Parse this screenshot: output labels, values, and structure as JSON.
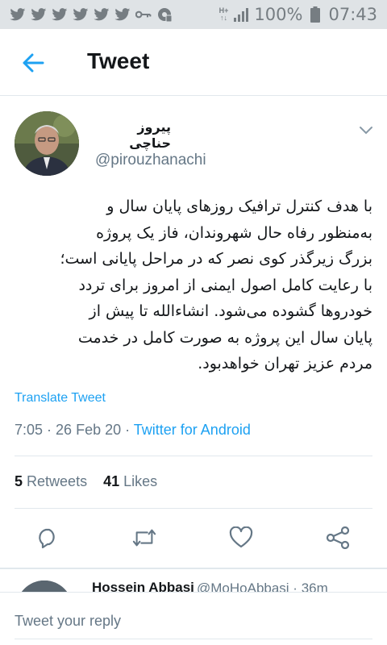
{
  "status_bar": {
    "notification_icons": [
      "twitter-icon",
      "twitter-icon",
      "twitter-icon",
      "twitter-icon",
      "twitter-icon",
      "twitter-icon",
      "key-icon",
      "vpn-icon"
    ],
    "network_type_top": "H+",
    "network_type_bottom": "↑↓",
    "battery": "100%",
    "time": "07:43"
  },
  "header": {
    "title": "Tweet",
    "back_icon": "arrow-left-icon"
  },
  "tweet": {
    "author_name": "پیروز حناچی",
    "author_handle": "@pirouzhanachi",
    "text_lines": [
      "با هدف کنترل ترافیک روزهای پایان سال و",
      "به‌منظور رفاه حال شهروندان، فاز یک پروژه",
      "بزرگ زیرگذر کوی نصر که در مراحل پایانی است؛",
      "با رعایت کامل اصول ایمنی از امروز برای تردد",
      "خودروها گشوده می‌شود. انشاءالله تا پیش از",
      "پایان سال این پروژه به صورت کامل در خدمت",
      "مردم عزیز تهران خواهدبود."
    ],
    "translate_label": "Translate Tweet",
    "time": "7:05",
    "date": "26 Feb 20",
    "source": "Twitter for Android",
    "separator": " · ",
    "retweets_count": "5",
    "retweets_label": "Retweets",
    "likes_count": "41",
    "likes_label": "Likes"
  },
  "actions": [
    "reply-icon",
    "retweet-icon",
    "like-icon",
    "share-icon"
  ],
  "next_reply": {
    "name": "Hossein Abbasi",
    "meta": "@MoHoAbbasi · 36m"
  },
  "reply_bar": {
    "placeholder": "Tweet your reply"
  },
  "colors": {
    "accent": "#1da1f2",
    "secondary_text": "#657786",
    "status_bar_bg": "#dfe3e6",
    "divider": "#e1e8ed"
  }
}
